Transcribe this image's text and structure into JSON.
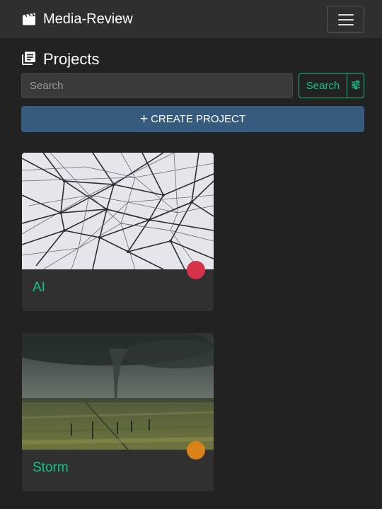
{
  "navbar": {
    "brand_icon": "film-clapper-icon",
    "brand_label": "Media-Review",
    "menu_icon": "hamburger-menu-icon"
  },
  "page": {
    "heading_icon": "project-list-icon",
    "heading": "Projects"
  },
  "search": {
    "placeholder": "Search",
    "button_label": "Search",
    "filter_icon": "sliders-icon"
  },
  "create": {
    "icon": "plus-icon",
    "label": "CREATE PROJECT"
  },
  "projects": [
    {
      "title": "AI",
      "thumbnail": "network-lines-photo",
      "status_color": "#d6334b"
    },
    {
      "title": "Storm",
      "thumbnail": "tornado-field-photo",
      "status_color": "#d9821a"
    }
  ],
  "colors": {
    "accent": "#16c08d",
    "primary": "#375a7f",
    "background": "#222222"
  }
}
